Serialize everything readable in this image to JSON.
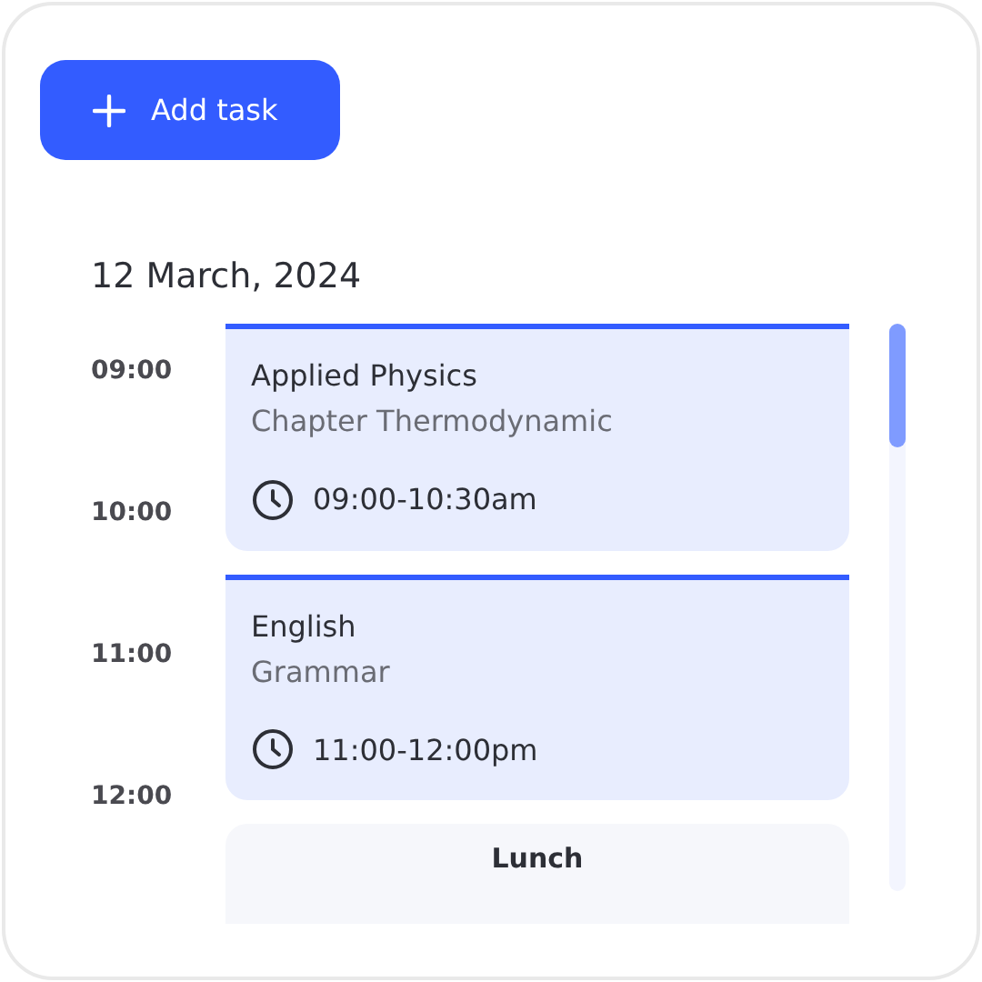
{
  "add_button": {
    "label": "Add task"
  },
  "date": "12 March, 2024",
  "times": [
    "09:00",
    "10:00",
    "11:00",
    "12:00"
  ],
  "tasks": [
    {
      "kind": "event",
      "title": "Applied Physics",
      "subtitle": "Chapter Thermodynamic",
      "time": "09:00-10:30am"
    },
    {
      "kind": "event",
      "title": "English",
      "subtitle": "Grammar",
      "time": "11:00-12:00pm"
    },
    {
      "kind": "break",
      "title": "Lunch"
    }
  ]
}
